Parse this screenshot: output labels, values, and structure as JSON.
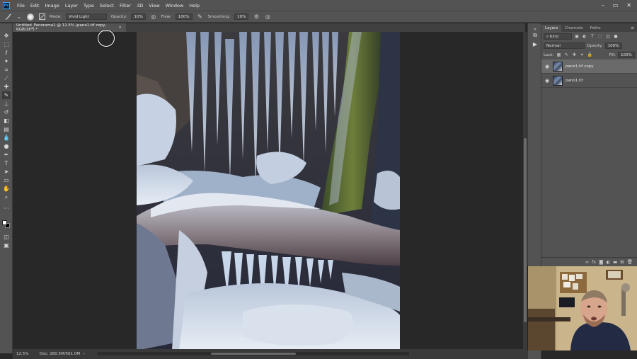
{
  "app": {
    "logo": "Ps",
    "menus": [
      "File",
      "Edit",
      "Image",
      "Layer",
      "Type",
      "Select",
      "Filter",
      "3D",
      "View",
      "Window",
      "Help"
    ],
    "window_controls": [
      "–",
      "▭",
      "✕"
    ]
  },
  "options": {
    "brush_size": "•",
    "mode_label": "Mode:",
    "mode_value": "Vivid Light",
    "opacity_label": "Opacity:",
    "opacity_value": "10%",
    "flow_label": "Flow:",
    "flow_value": "100%",
    "smoothing_label": "Smoothing:",
    "smoothing_value": "10%"
  },
  "document": {
    "tab_title": "Untitled_Panorama1 @ 12.5% (pano1.tif copy, RGB/16*) *",
    "close": "×"
  },
  "status": {
    "zoom": "12.5%",
    "doc_info": "Doc: 280.5M/561.0M",
    "arrow": "›"
  },
  "panel": {
    "tabs": [
      "Layers",
      "Channels",
      "Paths"
    ],
    "kind_label": "Kind",
    "blend_mode": "Normal",
    "opacity_label": "Opacity:",
    "opacity_value": "100%",
    "lock_label": "Lock:",
    "fill_label": "Fill:",
    "fill_value": "100%",
    "layers": [
      {
        "name": "pano1.tif copy",
        "selected": true
      },
      {
        "name": "pano1.tif",
        "selected": false
      }
    ]
  },
  "colors": {
    "chrome": "#535353",
    "canvas_bg": "#282828",
    "accent": "#31a8ff"
  }
}
